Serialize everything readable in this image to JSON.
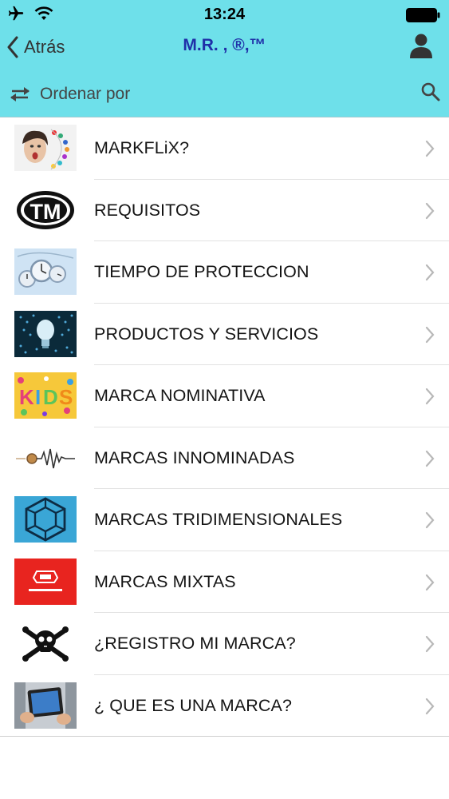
{
  "status": {
    "time": "13:24"
  },
  "nav": {
    "back_label": "Atrás",
    "title": "M.R. , ®,™"
  },
  "toolbar": {
    "sort_label": "Ordenar por"
  },
  "items": [
    {
      "label": "MARKFLiX?",
      "icon": "face-icon"
    },
    {
      "label": "REQUISITOS",
      "icon": "tm-logo-icon"
    },
    {
      "label": "TIEMPO DE PROTECCION",
      "icon": "clocks-icon"
    },
    {
      "label": "PRODUCTOS Y SERVICIOS",
      "icon": "lightbulb-icon"
    },
    {
      "label": "MARCA NOMINATIVA",
      "icon": "kids-text-icon"
    },
    {
      "label": "MARCAS INNOMINADAS",
      "icon": "soundwave-icon"
    },
    {
      "label": "MARCAS TRIDIMENSIONALES",
      "icon": "hexagon-cube-icon"
    },
    {
      "label": "MARCAS MIXTAS",
      "icon": "red-logo-icon"
    },
    {
      "label": "¿REGISTRO MI MARCA?",
      "icon": "skull-crossbones-icon"
    },
    {
      "label": "¿ QUE ES UNA MARCA?",
      "icon": "tablet-hands-icon"
    }
  ],
  "colors": {
    "header_bg": "#6ee0ea",
    "title": "#1f2fa8",
    "chevron": "#b8b8b8"
  }
}
